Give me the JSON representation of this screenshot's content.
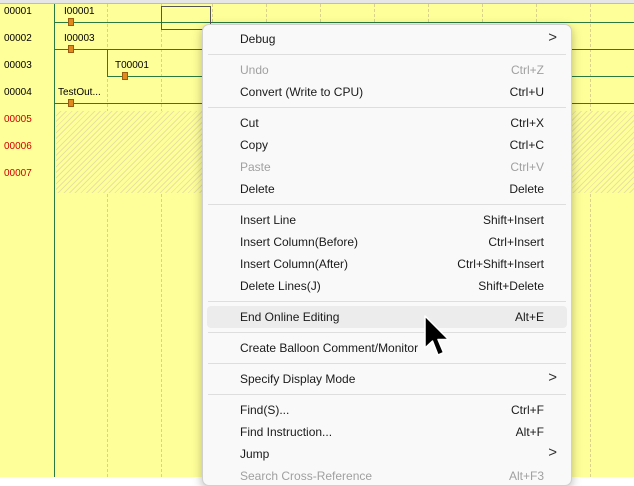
{
  "ladder": {
    "rows": [
      {
        "number": "00001",
        "label": "I00001",
        "active": true
      },
      {
        "number": "00002",
        "label": "I00003",
        "active": true
      },
      {
        "number": "00003",
        "label": "T00001",
        "active": true
      },
      {
        "number": "00004",
        "label": "TestOut...",
        "active": true
      },
      {
        "number": "00005",
        "label": "",
        "active": false
      },
      {
        "number": "00006",
        "label": "",
        "active": false
      },
      {
        "number": "00007",
        "label": "",
        "active": false
      }
    ]
  },
  "menu": {
    "debug": "Debug",
    "undo": {
      "label": "Undo",
      "shortcut": "Ctrl+Z"
    },
    "convert": {
      "label": "Convert (Write to CPU)",
      "shortcut": "Ctrl+U"
    },
    "cut": {
      "label": "Cut",
      "shortcut": "Ctrl+X"
    },
    "copy": {
      "label": "Copy",
      "shortcut": "Ctrl+C"
    },
    "paste": {
      "label": "Paste",
      "shortcut": "Ctrl+V"
    },
    "delete": {
      "label": "Delete",
      "shortcut": "Delete"
    },
    "insert_line": {
      "label": "Insert Line",
      "shortcut": "Shift+Insert"
    },
    "insert_col_before": {
      "label": "Insert Column(Before)",
      "shortcut": "Ctrl+Insert"
    },
    "insert_col_after": {
      "label": "Insert Column(After)",
      "shortcut": "Ctrl+Shift+Insert"
    },
    "delete_lines": {
      "label": "Delete Lines(J)",
      "shortcut": "Shift+Delete"
    },
    "end_online": {
      "label": "End Online Editing",
      "shortcut": "Alt+E"
    },
    "balloon": {
      "label": "Create Balloon Comment/Monitor"
    },
    "display_mode": {
      "label": "Specify Display Mode"
    },
    "find": {
      "label": "Find(S)...",
      "shortcut": "Ctrl+F"
    },
    "find_instruction": {
      "label": "Find Instruction...",
      "shortcut": "Alt+F"
    },
    "jump": {
      "label": "Jump"
    },
    "search_xref": {
      "label": "Search Cross-Reference",
      "shortcut": "Alt+F3"
    },
    "submenu_arrow": ">"
  }
}
